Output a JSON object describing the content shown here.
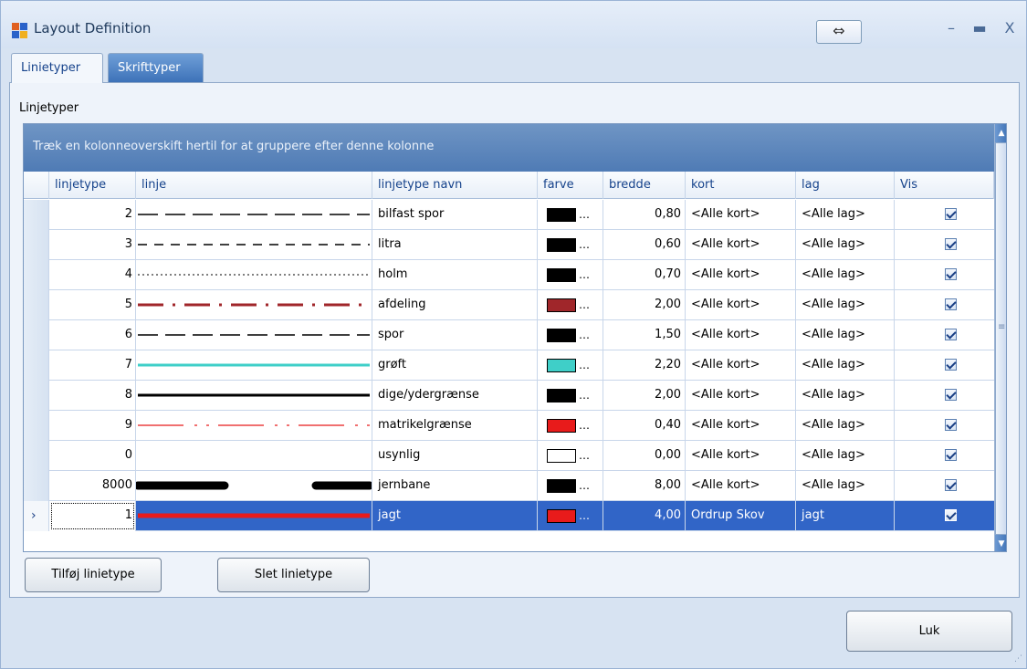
{
  "window": {
    "title": "Layout Definition"
  },
  "titlebar": {
    "swap_glyph": "⇔",
    "min_glyph": "–",
    "max_glyph": "▬",
    "close_glyph": "X"
  },
  "tabs": [
    {
      "label": "Linietyper"
    },
    {
      "label": "Skrifttyper"
    }
  ],
  "panel": {
    "group_label": "Linjetyper"
  },
  "grid": {
    "group_hint": "Træk en kolonneoverskift hertil for at gruppere efter denne kolonne",
    "columns": [
      "linjetype",
      "linje",
      "linjetype navn",
      "farve",
      "bredde",
      "kort",
      "lag",
      "Vis"
    ],
    "rows": [
      {
        "linjetype": "2",
        "style": "long-dash",
        "color": "#000000",
        "name": "bilfast spor",
        "bredde": "0,80",
        "kort": "<Alle kort>",
        "lag": "<Alle lag>",
        "vis": true
      },
      {
        "linjetype": "3",
        "style": "dash",
        "color": "#000000",
        "name": "litra",
        "bredde": "0,60",
        "kort": "<Alle kort>",
        "lag": "<Alle lag>",
        "vis": true
      },
      {
        "linjetype": "4",
        "style": "dot",
        "color": "#000000",
        "name": "holm",
        "bredde": "0,70",
        "kort": "<Alle kort>",
        "lag": "<Alle lag>",
        "vis": true
      },
      {
        "linjetype": "5",
        "style": "dash-dot",
        "color": "#a0262a",
        "name": "afdeling",
        "bredde": "2,00",
        "kort": "<Alle kort>",
        "lag": "<Alle lag>",
        "vis": true
      },
      {
        "linjetype": "6",
        "style": "long-dash",
        "color": "#000000",
        "name": "spor",
        "bredde": "1,50",
        "kort": "<Alle kort>",
        "lag": "<Alle lag>",
        "vis": true
      },
      {
        "linjetype": "7",
        "style": "solid",
        "color": "#3fcfc8",
        "name": "grøft",
        "bredde": "2,20",
        "kort": "<Alle kort>",
        "lag": "<Alle lag>",
        "vis": true
      },
      {
        "linjetype": "8",
        "style": "solid",
        "color": "#000000",
        "name": "dige/ydergrænse",
        "bredde": "2,00",
        "kort": "<Alle kort>",
        "lag": "<Alle lag>",
        "vis": true
      },
      {
        "linjetype": "9",
        "style": "dash-dot-dot",
        "color": "#e81b1b",
        "name": "matrikelgrænse",
        "bredde": "0,40",
        "kort": "<Alle kort>",
        "lag": "<Alle lag>",
        "vis": true
      },
      {
        "linjetype": "0",
        "style": "none",
        "color": "#ffffff",
        "name": "usynlig",
        "bredde": "0,00",
        "kort": "<Alle kort>",
        "lag": "<Alle lag>",
        "vis": true
      },
      {
        "linjetype": "8000",
        "style": "rail",
        "color": "#000000",
        "name": "jernbane",
        "bredde": "8,00",
        "kort": "<Alle kort>",
        "lag": "<Alle lag>",
        "vis": true
      },
      {
        "linjetype": "1",
        "style": "solid-thick",
        "color": "#e81b1b",
        "name": "jagt",
        "bredde": "4,00",
        "kort": "Ordrup Skov",
        "lag": "jagt",
        "vis": true,
        "selected": true
      }
    ]
  },
  "buttons": {
    "add": "Tilføj linietype",
    "delete": "Slet linietype",
    "close": "Luk"
  }
}
